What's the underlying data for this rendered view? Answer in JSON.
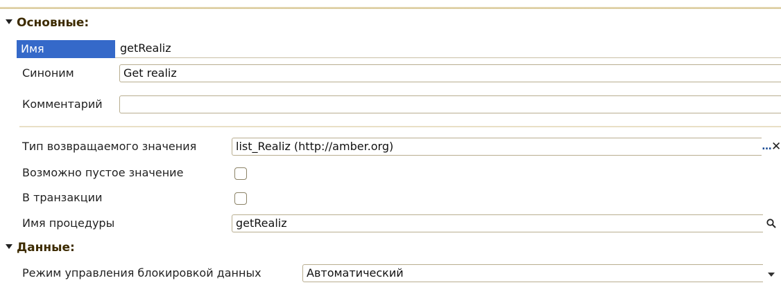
{
  "sections": {
    "main": {
      "label": "Основные:"
    },
    "data": {
      "label": "Данные:"
    }
  },
  "fields": {
    "name": {
      "label": "Имя",
      "value": "getRealiz"
    },
    "synonym": {
      "label": "Синоним",
      "value": "Get realiz"
    },
    "comment": {
      "label": "Комментарий",
      "value": ""
    },
    "return_type": {
      "label": "Тип возвращаемого значения",
      "value": "list_Realiz (http://amber.org)"
    },
    "nullable": {
      "label": "Возможно пустое значение",
      "checked": false
    },
    "transactional": {
      "label": "В транзакции",
      "checked": false
    },
    "procedure_name": {
      "label": "Имя процедуры",
      "value": "getRealiz"
    },
    "lock_mode": {
      "label": "Режим управления блокировкой данных",
      "value": "Автоматический"
    }
  },
  "icons": {
    "section_toggle": "triangle-down-icon",
    "select": "ellipsis-icon",
    "clear": "close-icon",
    "search": "search-icon",
    "dropdown": "chevron-down-icon"
  },
  "colors": {
    "selected_label_bg": "#3569c9",
    "section_text": "#3d2b00"
  }
}
